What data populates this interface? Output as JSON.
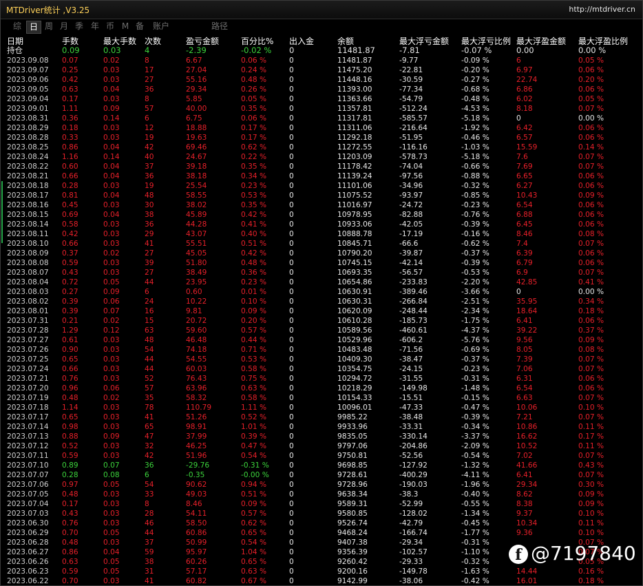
{
  "window": {
    "title": "MTDriver统计 ,V3.25",
    "url": "http://mtdriver.cn"
  },
  "tabs": [
    {
      "label": "综",
      "active": false
    },
    {
      "label": "日",
      "active": true
    },
    {
      "label": "周",
      "active": false
    },
    {
      "label": "月",
      "active": false
    },
    {
      "label": "季",
      "active": false
    },
    {
      "label": "年",
      "active": false
    },
    {
      "label": "币",
      "active": false
    },
    {
      "label": "M",
      "active": false
    },
    {
      "label": "备",
      "active": false
    },
    {
      "label": "账户",
      "active": false
    },
    {
      "label": "路径",
      "active": false
    }
  ],
  "columns": [
    "日期",
    "手数",
    "最大手数",
    "次数",
    "盈亏金额",
    "百分比%",
    "出入金",
    "余额",
    "最大浮亏金额",
    "最大浮亏比例",
    "最大浮盈金额",
    "最大浮盈比例"
  ],
  "rows": [
    [
      "持仓",
      "0.09",
      "0.03",
      "4",
      "-2.39",
      "-0.02 %",
      "0",
      "11481.87",
      "-7.81",
      "-0.07 %",
      "0.00",
      "0.00 %"
    ],
    [
      "2023.09.08",
      "0.07",
      "0.02",
      "8",
      "6.67",
      "0.06 %",
      "0",
      "11481.87",
      "-9.77",
      "-0.09 %",
      "6",
      "0.05 %"
    ],
    [
      "2023.09.07",
      "0.25",
      "0.03",
      "17",
      "27.04",
      "0.24 %",
      "0",
      "11475.20",
      "-22.81",
      "-0.20 %",
      "6.97",
      "0.06 %"
    ],
    [
      "2023.09.06",
      "0.42",
      "0.03",
      "27",
      "55.16",
      "0.48 %",
      "0",
      "11448.16",
      "-30.59",
      "-0.27 %",
      "22.74",
      "0.20 %"
    ],
    [
      "2023.09.05",
      "0.63",
      "0.04",
      "36",
      "29.34",
      "0.26 %",
      "0",
      "11393.00",
      "-77.34",
      "-0.68 %",
      "6.86",
      "0.06 %"
    ],
    [
      "2023.09.04",
      "0.17",
      "0.03",
      "8",
      "5.85",
      "0.05 %",
      "0",
      "11363.66",
      "-54.79",
      "-0.48 %",
      "6.02",
      "0.05 %"
    ],
    [
      "2023.09.01",
      "1.11",
      "0.09",
      "57",
      "40.00",
      "0.35 %",
      "0",
      "11357.81",
      "-512.24",
      "-4.53 %",
      "8.18",
      "0.07 %"
    ],
    [
      "2023.08.31",
      "0.36",
      "0.14",
      "6",
      "6.75",
      "0.06 %",
      "0",
      "11317.81",
      "-585.57",
      "-5.18 %",
      "0",
      "0.00 %"
    ],
    [
      "2023.08.29",
      "0.18",
      "0.03",
      "12",
      "18.88",
      "0.17 %",
      "0",
      "11311.06",
      "-216.64",
      "-1.92 %",
      "6.42",
      "0.06 %"
    ],
    [
      "2023.08.28",
      "0.33",
      "0.03",
      "19",
      "19.63",
      "0.17 %",
      "0",
      "11292.18",
      "-51.95",
      "-0.46 %",
      "6.57",
      "0.06 %"
    ],
    [
      "2023.08.25",
      "0.86",
      "0.04",
      "42",
      "69.46",
      "0.62 %",
      "0",
      "11272.55",
      "-116.16",
      "-1.03 %",
      "15.59",
      "0.14 %"
    ],
    [
      "2023.08.24",
      "1.16",
      "0.14",
      "40",
      "24.67",
      "0.22 %",
      "0",
      "11203.09",
      "-578.73",
      "-5.18 %",
      "7.6",
      "0.07 %"
    ],
    [
      "2023.08.22",
      "0.60",
      "0.04",
      "37",
      "39.18",
      "0.35 %",
      "0",
      "11178.42",
      "-74.04",
      "-0.66 %",
      "7.69",
      "0.07 %"
    ],
    [
      "2023.08.21",
      "0.66",
      "0.04",
      "36",
      "38.18",
      "0.34 %",
      "0",
      "11139.24",
      "-97.56",
      "-0.88 %",
      "6.65",
      "0.06 %"
    ],
    [
      "2023.08.18",
      "0.28",
      "0.03",
      "19",
      "25.54",
      "0.23 %",
      "0",
      "11101.06",
      "-34.96",
      "-0.32 %",
      "6.27",
      "0.06 %"
    ],
    [
      "2023.08.17",
      "0.81",
      "0.04",
      "48",
      "58.55",
      "0.53 %",
      "0",
      "11075.52",
      "-93.97",
      "-0.85 %",
      "10.43",
      "0.09 %"
    ],
    [
      "2023.08.16",
      "0.45",
      "0.03",
      "30",
      "38.02",
      "0.35 %",
      "0",
      "11016.97",
      "-24.72",
      "-0.23 %",
      "6.54",
      "0.06 %"
    ],
    [
      "2023.08.15",
      "0.69",
      "0.04",
      "38",
      "45.89",
      "0.42 %",
      "0",
      "10978.95",
      "-82.88",
      "-0.76 %",
      "6.88",
      "0.06 %"
    ],
    [
      "2023.08.14",
      "0.58",
      "0.03",
      "36",
      "44.28",
      "0.41 %",
      "0",
      "10933.06",
      "-42.05",
      "-0.39 %",
      "6.45",
      "0.06 %"
    ],
    [
      "2023.08.11",
      "0.42",
      "0.03",
      "29",
      "43.07",
      "0.40 %",
      "0",
      "10888.78",
      "-17.19",
      "-0.16 %",
      "8.46",
      "0.08 %"
    ],
    [
      "2023.08.10",
      "0.66",
      "0.03",
      "41",
      "55.51",
      "0.51 %",
      "0",
      "10845.71",
      "-66.6",
      "-0.62 %",
      "7.4",
      "0.07 %"
    ],
    [
      "2023.08.09",
      "0.37",
      "0.02",
      "27",
      "45.05",
      "0.42 %",
      "0",
      "10790.20",
      "-39.87",
      "-0.37 %",
      "6.39",
      "0.06 %"
    ],
    [
      "2023.08.08",
      "0.59",
      "0.03",
      "39",
      "51.80",
      "0.48 %",
      "0",
      "10745.15",
      "-42.14",
      "-0.39 %",
      "6.79",
      "0.06 %"
    ],
    [
      "2023.08.07",
      "0.43",
      "0.03",
      "27",
      "38.49",
      "0.36 %",
      "0",
      "10693.35",
      "-56.57",
      "-0.53 %",
      "6.9",
      "0.07 %"
    ],
    [
      "2023.08.04",
      "0.72",
      "0.05",
      "44",
      "23.95",
      "0.23 %",
      "0",
      "10654.86",
      "-233.83",
      "-2.20 %",
      "42.85",
      "0.41 %"
    ],
    [
      "2023.08.03",
      "0.27",
      "0.09",
      "6",
      "0.60",
      "0.01 %",
      "0",
      "10630.91",
      "-389.46",
      "-3.66 %",
      "0",
      "0.00 %"
    ],
    [
      "2023.08.02",
      "0.39",
      "0.06",
      "24",
      "10.22",
      "0.10 %",
      "0",
      "10630.31",
      "-266.84",
      "-2.51 %",
      "35.95",
      "0.34 %"
    ],
    [
      "2023.08.01",
      "0.39",
      "0.07",
      "16",
      "9.81",
      "0.09 %",
      "0",
      "10620.09",
      "-248.44",
      "-2.34 %",
      "18.64",
      "0.18 %"
    ],
    [
      "2023.07.31",
      "0.21",
      "0.02",
      "15",
      "20.72",
      "0.20 %",
      "0",
      "10610.28",
      "-185.73",
      "-1.75 %",
      "6.41",
      "0.06 %"
    ],
    [
      "2023.07.28",
      "1.29",
      "0.12",
      "63",
      "59.60",
      "0.57 %",
      "0",
      "10589.56",
      "-460.61",
      "-4.37 %",
      "39.22",
      "0.37 %"
    ],
    [
      "2023.07.27",
      "0.61",
      "0.03",
      "48",
      "46.48",
      "0.44 %",
      "0",
      "10529.96",
      "-606.2",
      "-5.76 %",
      "9.56",
      "0.09 %"
    ],
    [
      "2023.07.26",
      "0.90",
      "0.03",
      "54",
      "74.18",
      "0.71 %",
      "0",
      "10483.48",
      "-71.56",
      "-0.69 %",
      "8.05",
      "0.08 %"
    ],
    [
      "2023.07.25",
      "0.65",
      "0.03",
      "44",
      "54.55",
      "0.53 %",
      "0",
      "10409.30",
      "-38.47",
      "-0.37 %",
      "7.39",
      "0.07 %"
    ],
    [
      "2023.07.24",
      "0.66",
      "0.03",
      "44",
      "60.03",
      "0.58 %",
      "0",
      "10354.75",
      "-24.15",
      "-0.23 %",
      "7.06",
      "0.07 %"
    ],
    [
      "2023.07.21",
      "0.76",
      "0.03",
      "52",
      "76.43",
      "0.75 %",
      "0",
      "10294.72",
      "-31.55",
      "-0.31 %",
      "6.31",
      "0.06 %"
    ],
    [
      "2023.07.20",
      "0.96",
      "0.06",
      "57",
      "63.96",
      "0.63 %",
      "0",
      "10218.29",
      "-149.98",
      "-1.48 %",
      "6.54",
      "0.06 %"
    ],
    [
      "2023.07.19",
      "0.48",
      "0.02",
      "35",
      "58.32",
      "0.58 %",
      "0",
      "10154.33",
      "-15.51",
      "-0.15 %",
      "6.63",
      "0.07 %"
    ],
    [
      "2023.07.18",
      "1.14",
      "0.03",
      "78",
      "110.79",
      "1.11 %",
      "0",
      "10096.01",
      "-47.33",
      "-0.47 %",
      "10.06",
      "0.10 %"
    ],
    [
      "2023.07.17",
      "0.65",
      "0.03",
      "41",
      "51.26",
      "0.52 %",
      "0",
      "9985.22",
      "-38.48",
      "-0.39 %",
      "7.21",
      "0.07 %"
    ],
    [
      "2023.07.14",
      "0.98",
      "0.03",
      "65",
      "98.91",
      "1.01 %",
      "0",
      "9933.96",
      "-33.31",
      "-0.34 %",
      "10.86",
      "0.11 %"
    ],
    [
      "2023.07.13",
      "0.88",
      "0.09",
      "47",
      "37.99",
      "0.39 %",
      "0",
      "9835.05",
      "-330.14",
      "-3.37 %",
      "16.62",
      "0.17 %"
    ],
    [
      "2023.07.12",
      "0.52",
      "0.03",
      "32",
      "46.25",
      "0.47 %",
      "0",
      "9797.06",
      "-204.86",
      "-2.09 %",
      "10.52",
      "0.11 %"
    ],
    [
      "2023.07.11",
      "0.59",
      "0.03",
      "42",
      "51.96",
      "0.54 %",
      "0",
      "9750.81",
      "-52.56",
      "-0.54 %",
      "7.02",
      "0.07 %"
    ],
    [
      "2023.07.10",
      "0.89",
      "0.07",
      "36",
      "-29.76",
      "-0.31 %",
      "0",
      "9698.85",
      "-127.92",
      "-1.32 %",
      "41.66",
      "0.43 %"
    ],
    [
      "2023.07.07",
      "0.28",
      "0.08",
      "6",
      "-0.35",
      "-0.00 %",
      "0",
      "9728.61",
      "-400.29",
      "-4.11 %",
      "6.41",
      "0.07 %"
    ],
    [
      "2023.07.06",
      "0.97",
      "0.05",
      "54",
      "90.62",
      "0.94 %",
      "0",
      "9728.96",
      "-190.03",
      "-1.96 %",
      "29.34",
      "0.30 %"
    ],
    [
      "2023.07.05",
      "0.48",
      "0.03",
      "33",
      "49.03",
      "0.51 %",
      "0",
      "9638.34",
      "-38.3",
      "-0.40 %",
      "8.62",
      "0.09 %"
    ],
    [
      "2023.07.04",
      "0.17",
      "0.03",
      "8",
      "8.46",
      "0.09 %",
      "0",
      "9589.31",
      "-52.99",
      "-0.55 %",
      "8.38",
      "0.09 %"
    ],
    [
      "2023.07.03",
      "0.43",
      "0.03",
      "28",
      "54.11",
      "0.57 %",
      "0",
      "9580.85",
      "-128.02",
      "-1.34 %",
      "9.37",
      "0.10 %"
    ],
    [
      "2023.06.30",
      "0.76",
      "0.03",
      "46",
      "58.50",
      "0.62 %",
      "0",
      "9526.74",
      "-42.79",
      "-0.45 %",
      "10.34",
      "0.11 %"
    ],
    [
      "2023.06.29",
      "0.70",
      "0.05",
      "44",
      "60.86",
      "0.65 %",
      "0",
      "9468.24",
      "-166.74",
      "-1.77 %",
      "9.36",
      "0.10 %"
    ],
    [
      "2023.06.28",
      "0.48",
      "0.03",
      "37",
      "50.99",
      "0.54 %",
      "0",
      "9407.38",
      "-29.34",
      "-0.31 %",
      "",
      "0.07 %"
    ],
    [
      "2023.06.27",
      "0.86",
      "0.04",
      "59",
      "95.97",
      "1.04 %",
      "0",
      "9356.39",
      "-102.57",
      "-1.10 %",
      "",
      "0.07 %"
    ],
    [
      "2023.06.26",
      "0.63",
      "0.05",
      "38",
      "60.26",
      "0.65 %",
      "0",
      "9260.42",
      "-29.33",
      "-0.32 %",
      "",
      "0.05 %"
    ],
    [
      "2023.06.23",
      "0.59",
      "0.05",
      "31",
      "57.17",
      "0.63 %",
      "0",
      "9200.16",
      "-149.78",
      "-1.63 %",
      "14.44",
      "0.16 %"
    ],
    [
      "2023.06.22",
      "0.70",
      "0.03",
      "41",
      "60.82",
      "0.67 %",
      "0",
      "9142.99",
      "-38.06",
      "-0.42 %",
      "16.01",
      "0.18 %"
    ]
  ],
  "watermark": {
    "text": "@7197840",
    "icon": "facebook-icon"
  },
  "colors": {
    "positive": "#e8202a",
    "negative": "#3cd43c",
    "neutral": "#e8e8e8",
    "title": "#ffd25a"
  }
}
